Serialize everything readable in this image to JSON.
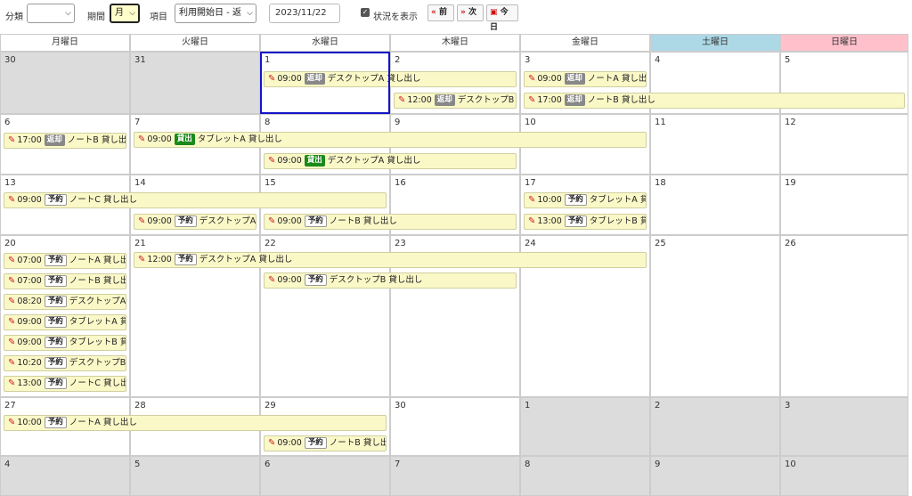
{
  "toolbar": {
    "category_label": "分類",
    "category_value": "",
    "period_label": "期間",
    "period_value": "月",
    "item_label": "項目",
    "item_value": "利用開始日 - 返",
    "date_value": "2023/11/22",
    "status_label": "状況を表示",
    "prev_label": "前",
    "next_label": "次",
    "today_label": "今日"
  },
  "weekdays": [
    "月曜日",
    "火曜日",
    "水曜日",
    "木曜日",
    "金曜日",
    "土曜日",
    "日曜日"
  ],
  "weekday_colors": {
    "saturday": "#add8e6",
    "sunday": "#ffc0cb"
  },
  "status_names": {
    "return": "返却",
    "lend": "貸出",
    "reserve": "予約"
  },
  "weeks": [
    {
      "days": [
        "30",
        "31",
        "1",
        "2",
        "3",
        "4",
        "5"
      ]
    },
    {
      "days": [
        "6",
        "7",
        "8",
        "9",
        "10",
        "11",
        "12"
      ]
    },
    {
      "days": [
        "13",
        "14",
        "15",
        "16",
        "17",
        "18",
        "19"
      ]
    },
    {
      "days": [
        "20",
        "21",
        "22",
        "23",
        "24",
        "25",
        "26"
      ]
    },
    {
      "days": [
        "27",
        "28",
        "29",
        "30",
        "1",
        "2",
        "3"
      ]
    },
    {
      "days": [
        "4",
        "5",
        "6",
        "7",
        "8",
        "9",
        "10"
      ]
    }
  ],
  "events": [
    {
      "time": "09:00",
      "status": "返却",
      "text": "デスクトップA 貸し出し"
    },
    {
      "time": "12:00",
      "status": "返却",
      "text": "デスクトップB 貸"
    },
    {
      "time": "09:00",
      "status": "返却",
      "text": "ノートA 貸し出し"
    },
    {
      "time": "17:00",
      "status": "返却",
      "text": "ノートB 貸し出し"
    },
    {
      "time": "17:00",
      "status": "返却",
      "text": "ノートB 貸し出し"
    },
    {
      "time": "09:00",
      "status": "貸出",
      "text": "タブレットA 貸し出し"
    },
    {
      "time": "09:00",
      "status": "貸出",
      "text": "デスクトップA 貸し出し"
    },
    {
      "time": "09:00",
      "status": "予約",
      "text": "ノートC 貸し出し"
    },
    {
      "time": "09:00",
      "status": "予約",
      "text": "デスクトップA 貸"
    },
    {
      "time": "09:00",
      "status": "予約",
      "text": "ノートB 貸し出し"
    },
    {
      "time": "10:00",
      "status": "予約",
      "text": "タブレットA 貸し"
    },
    {
      "time": "13:00",
      "status": "予約",
      "text": "タブレットB 貸し"
    },
    {
      "time": "07:00",
      "status": "予約",
      "text": "ノートA 貸し出し"
    },
    {
      "time": "07:00",
      "status": "予約",
      "text": "ノートB 貸し出"
    },
    {
      "time": "08:20",
      "status": "予約",
      "text": "デスクトップA 貸"
    },
    {
      "time": "09:00",
      "status": "予約",
      "text": "タブレットA 貸し"
    },
    {
      "time": "09:00",
      "status": "予約",
      "text": "タブレットB 貸し"
    },
    {
      "time": "10:20",
      "status": "予約",
      "text": "デスクトップB 貸"
    },
    {
      "time": "13:00",
      "status": "予約",
      "text": "ノートC 貸し出"
    },
    {
      "time": "12:00",
      "status": "予約",
      "text": "デスクトップA 貸し出し"
    },
    {
      "time": "09:00",
      "status": "予約",
      "text": "デスクトップB 貸し出し"
    },
    {
      "time": "10:00",
      "status": "予約",
      "text": "ノートA 貸し出し"
    },
    {
      "time": "09:00",
      "status": "予約",
      "text": "ノートB 貸し出し"
    }
  ]
}
